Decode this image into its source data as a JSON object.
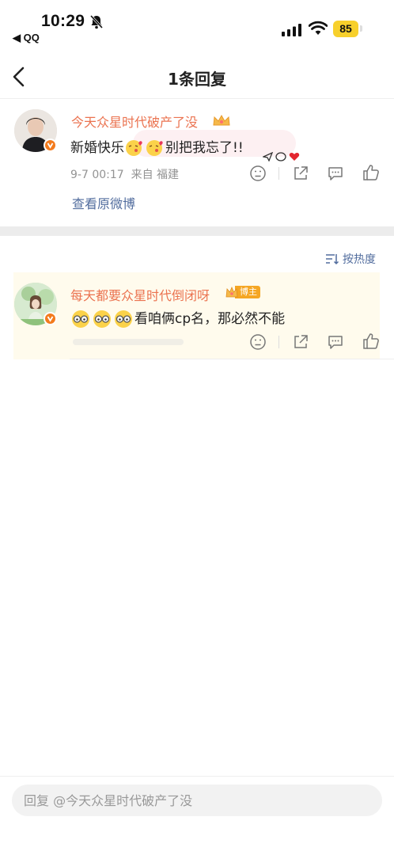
{
  "status_bar": {
    "time": "10:29",
    "back_app": "◀ QQ",
    "battery": "85"
  },
  "nav": {
    "title": "1条回复"
  },
  "original_comment": {
    "username": "今天众星时代破产了没",
    "text_prefix": "新婚快乐",
    "text_suffix": "别把我忘了!!",
    "date": "9-7 00:17",
    "source": "来自 福建",
    "view_original_link": "查看原微博"
  },
  "sort": {
    "label": "按热度"
  },
  "reply": {
    "username": "每天都要众星时代倒闭呀",
    "badge": "博主",
    "text": "看咱俩cp名，那必然不能"
  },
  "bottom_bar": {
    "placeholder": "回复 @今天众星时代破产了没"
  },
  "colors": {
    "username": "#eb7350",
    "link": "#526d9e",
    "reply_bg": "#fffbed",
    "badge_bg": "#f5a623",
    "battery": "#f7d02c"
  }
}
